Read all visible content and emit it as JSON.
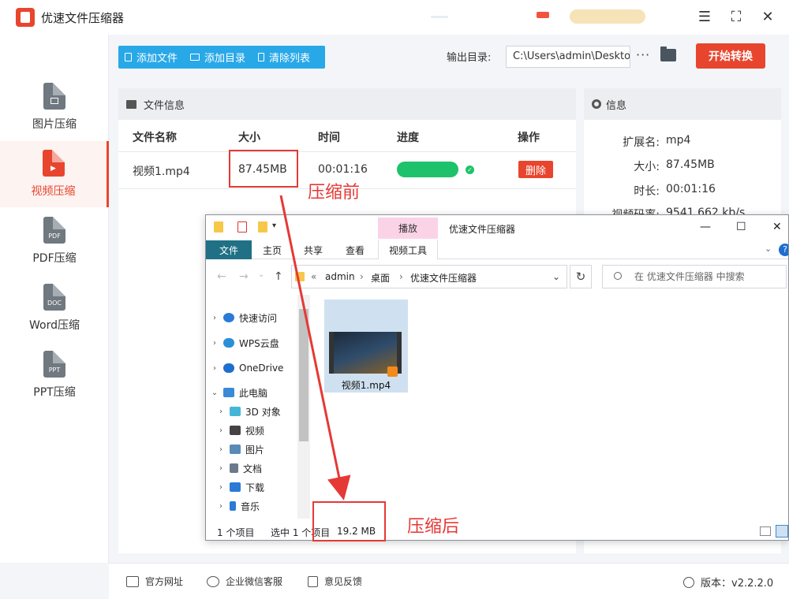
{
  "app": {
    "title": "优速文件压缩器",
    "window_controls": {
      "menu": "☰",
      "maximize": "⛶",
      "close": "✕"
    }
  },
  "sidebar": {
    "items": [
      {
        "label": "图片压缩",
        "icon": "image-doc-icon",
        "badge": ""
      },
      {
        "label": "视频压缩",
        "icon": "video-doc-icon",
        "badge": "",
        "active": true
      },
      {
        "label": "PDF压缩",
        "icon": "pdf-doc-icon",
        "badge": "PDF"
      },
      {
        "label": "Word压缩",
        "icon": "word-doc-icon",
        "badge": "DOC"
      },
      {
        "label": "PPT压缩",
        "icon": "ppt-doc-icon",
        "badge": "PPT"
      }
    ]
  },
  "toolbar": {
    "add_file": "添加文件",
    "add_folder": "添加目录",
    "clear_list": "清除列表",
    "output_label": "输出目录:",
    "output_path": "C:\\Users\\admin\\Deskto",
    "more": "···",
    "start": "开始转换"
  },
  "file_panel": {
    "title": "文件信息",
    "columns": {
      "name": "文件名称",
      "size": "大小",
      "time": "时间",
      "progress": "进度",
      "action": "操作"
    },
    "rows": [
      {
        "name": "视频1.mp4",
        "size": "87.45MB",
        "time": "00:01:16",
        "progress": 1.0,
        "delete": "删除"
      }
    ]
  },
  "info_panel": {
    "title": "信息",
    "rows": [
      {
        "key": "扩展名:",
        "value": "mp4"
      },
      {
        "key": "大小:",
        "value": "87.45MB"
      },
      {
        "key": "时长:",
        "value": "00:01:16"
      },
      {
        "key": "视频码率:",
        "value": "9541.662 kb/s"
      }
    ]
  },
  "footer": {
    "website": "官方网址",
    "wechat": "企业微信客服",
    "feedback": "意见反馈",
    "version": "版本：v2.2.2.0"
  },
  "explorer": {
    "play_tab": "播放",
    "title": "优速文件压缩器",
    "ribbon": {
      "file": "文件",
      "home": "主页",
      "share": "共享",
      "view": "查看",
      "video_tools": "视频工具"
    },
    "breadcrumbs": [
      "admin",
      "桌面",
      "优速文件压缩器"
    ],
    "search_placeholder": "在 优速文件压缩器 中搜索",
    "nav": [
      {
        "label": "快速访问",
        "color": "#2a7ad6"
      },
      {
        "label": "WPS云盘",
        "color": "#2a8fd6"
      },
      {
        "label": "OneDrive",
        "color": "#1e6fcf"
      },
      {
        "label": "此电脑",
        "color": "#3a8ad6"
      },
      {
        "label": "3D 对象",
        "color": "#46b6d8"
      },
      {
        "label": "视频",
        "color": "#444"
      },
      {
        "label": "图片",
        "color": "#5a8ab6"
      },
      {
        "label": "文档",
        "color": "#6a7a8a"
      },
      {
        "label": "下载",
        "color": "#2a7ad6"
      },
      {
        "label": "音乐",
        "color": "#2a7ad6"
      }
    ],
    "file": {
      "name": "视频1.mp4"
    },
    "status": {
      "count": "1 个项目",
      "selected": "选中 1 个项目",
      "size": "19.2 MB"
    }
  },
  "annotations": {
    "before": "压缩前",
    "after": "压缩后"
  },
  "colors": {
    "accent": "#e8452e",
    "toolbar": "#29a8e8",
    "progress": "#1ec26a",
    "annotation": "#e53935"
  }
}
